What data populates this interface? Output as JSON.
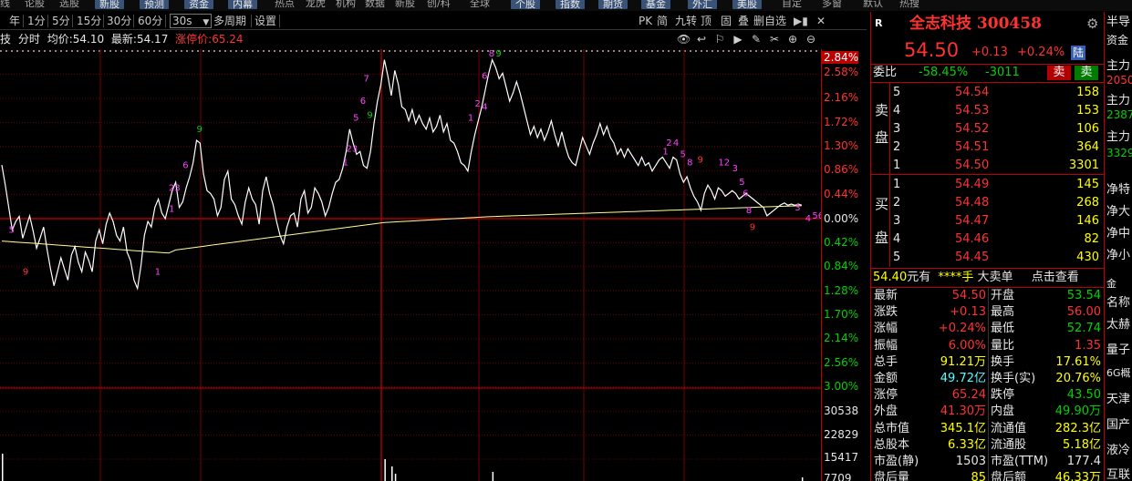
{
  "topnav": {
    "items": [
      "线",
      "论股",
      "选股",
      "新股",
      "预测",
      "资金",
      "内幕",
      "热点",
      "龙虎",
      "机构",
      "数据",
      "新股",
      "创/科",
      "全球",
      "个股",
      "指数",
      "期货",
      "基金",
      "外汇",
      "美股",
      "自定",
      "多窗",
      "默认",
      "热搜"
    ],
    "active_items": [
      "新股",
      "预测",
      "资金",
      "内幕",
      "个股",
      "指数",
      "期货",
      "基金",
      "外汇",
      "美股"
    ]
  },
  "periodbar": {
    "items": [
      "年",
      "1分",
      "5分",
      "15分",
      "30分",
      "60分",
      "30s",
      "多周期",
      "设置"
    ],
    "dropdown_arrow": "▼",
    "right_items": [
      "PK",
      "简",
      "九转",
      "顶",
      "固",
      "叠",
      "删自选"
    ]
  },
  "info": {
    "prefix": "技",
    "mode": "分时",
    "avg_label": "均价:",
    "avg_value": "54.10",
    "latest_label": "最新:",
    "latest_value": "54.17",
    "limit_label": "涨停价:",
    "limit_value": "65.24"
  },
  "chart_tools": [
    "eye-icon",
    "back-icon",
    "flag-icon",
    "play-icon",
    "draw-icon",
    "scissors-icon",
    "plus-icon",
    "minus-icon"
  ],
  "yaxis_labels": {
    "top_badge": "2.84%",
    "pct": [
      "2.58%",
      "2.16%",
      "1.72%",
      "1.30%",
      "0.86%",
      "0.44%",
      "0.00%",
      "0.42%",
      "0.84%",
      "1.28%",
      "1.70%",
      "2.14%",
      "2.56%",
      "3.00%"
    ],
    "vol": [
      "30538",
      "22829",
      "15417",
      "7709"
    ]
  },
  "chart_data": {
    "type": "line",
    "title": "全志科技 300458 分时",
    "ylabel": "",
    "reference_price": 54.37,
    "y_range_pct": [
      -3.0,
      3.0
    ],
    "series": [
      {
        "name": "price",
        "color": "#ffffff"
      },
      {
        "name": "avg",
        "color": "#ffff88"
      }
    ],
    "annotations_magenta": [
      "9",
      "2",
      "8",
      "1",
      "3",
      "6",
      "8",
      "9",
      "2",
      "4",
      "5",
      "2",
      "3",
      "8",
      "9",
      "1",
      "2",
      "3",
      "4",
      "5",
      "6",
      "7",
      "8",
      "9"
    ],
    "annotations_red": [
      "9",
      "9"
    ]
  },
  "quote": {
    "badge": "R",
    "name": "全志科技",
    "code": "300458",
    "price": "54.50",
    "change": "+0.13",
    "change_pct": "+0.24%",
    "market_tag": "陆",
    "weibi_label": "委比",
    "weibi_value": "-58.45%",
    "weicha_value": "-3011",
    "sell_btn": "卖",
    "buy_btn": "卖",
    "sell_side_label": [
      "卖",
      "盘"
    ],
    "buy_side_label": [
      "买",
      "盘"
    ],
    "asks": [
      {
        "level": "5",
        "price": "54.54",
        "vol": "158"
      },
      {
        "level": "4",
        "price": "54.53",
        "vol": "153"
      },
      {
        "level": "3",
        "price": "54.52",
        "vol": "106"
      },
      {
        "level": "2",
        "price": "54.51",
        "vol": "364"
      },
      {
        "level": "1",
        "price": "54.50",
        "vol": "3301"
      }
    ],
    "bids": [
      {
        "level": "1",
        "price": "54.49",
        "vol": "145"
      },
      {
        "level": "2",
        "price": "54.48",
        "vol": "268"
      },
      {
        "level": "3",
        "price": "54.47",
        "vol": "146"
      },
      {
        "level": "4",
        "price": "54.46",
        "vol": "82"
      },
      {
        "level": "5",
        "price": "54.45",
        "vol": "430"
      }
    ],
    "bigorder": {
      "price": "54.40",
      "unit": "元有",
      "stars": "****手",
      "label": "大卖单",
      "link": "点击查看"
    },
    "stats_left": [
      {
        "label": "最新",
        "value": "54.50",
        "color": "red"
      },
      {
        "label": "涨跌",
        "value": "+0.13",
        "color": "red"
      },
      {
        "label": "涨幅",
        "value": "+0.24%",
        "color": "red"
      },
      {
        "label": "振幅",
        "value": "6.00%",
        "color": "red"
      },
      {
        "label": "总手",
        "value": "91.21万",
        "color": "yellow"
      },
      {
        "label": "金额",
        "value": "49.72亿",
        "color": "cyan"
      },
      {
        "label": "涨停",
        "value": "65.24",
        "color": "red"
      },
      {
        "label": "外盘",
        "value": "41.30万",
        "color": "red"
      },
      {
        "label": "总市值",
        "value": "345.1亿",
        "color": "yellow"
      },
      {
        "label": "总股本",
        "value": "6.33亿",
        "color": "yellow"
      },
      {
        "label": "市盈(静)",
        "value": "1503",
        "color": "white"
      },
      {
        "label": "盘后量",
        "value": "85",
        "color": "yellow"
      }
    ],
    "stats_right": [
      {
        "label": "开盘",
        "value": "53.54",
        "color": "green"
      },
      {
        "label": "最高",
        "value": "56.00",
        "color": "red"
      },
      {
        "label": "最低",
        "value": "52.74",
        "color": "green"
      },
      {
        "label": "量比",
        "value": "1.35",
        "color": "red"
      },
      {
        "label": "换手",
        "value": "17.61%",
        "color": "yellow"
      },
      {
        "label": "换手(实)",
        "value": "20.76%",
        "color": "yellow"
      },
      {
        "label": "跌停",
        "value": "43.50",
        "color": "green"
      },
      {
        "label": "内盘",
        "value": "49.90万",
        "color": "green"
      },
      {
        "label": "流通值",
        "value": "282.3亿",
        "color": "yellow"
      },
      {
        "label": "流通股",
        "value": "5.18亿",
        "color": "yellow"
      },
      {
        "label": "市盈(TTM)",
        "value": "177.4",
        "color": "white"
      },
      {
        "label": "盘后额",
        "value": "46.33万",
        "color": "yellow"
      }
    ]
  },
  "side": {
    "items": [
      "半导",
      "资金",
      "主力",
      "2050",
      "主力",
      "2387",
      "主力",
      "3329",
      "净特",
      "净大",
      "净中",
      "净小",
      "金",
      "名称",
      "太赫",
      "量子",
      "6G概",
      "天津",
      "国产",
      "液冷",
      "互联"
    ]
  }
}
